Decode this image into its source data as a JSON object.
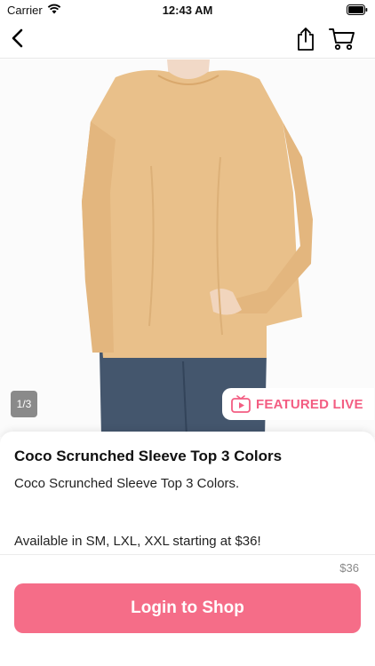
{
  "status_bar": {
    "carrier": "Carrier",
    "time": "12:43 AM"
  },
  "product": {
    "image_counter": "1/3",
    "featured_badge": "FEATURED LIVE",
    "title": "Coco Scrunched Sleeve Top 3 Colors",
    "description": "Coco Scrunched Sleeve Top 3 Colors.",
    "availability": "Available in SM, LXL, XXL starting at $36!",
    "price": "$36"
  },
  "actions": {
    "login_label": "Login to Shop"
  },
  "colors": {
    "accent": "#f56d88",
    "badge_text": "#f35d82",
    "top_color": "#e9c08a",
    "jeans": "#44566d"
  }
}
